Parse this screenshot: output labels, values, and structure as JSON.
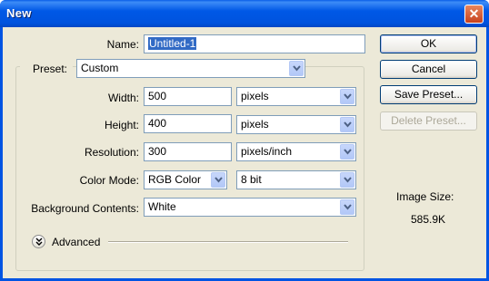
{
  "window": {
    "title": "New",
    "close_glyph": "✕"
  },
  "form": {
    "name_label": "Name:",
    "name_value": "Untitled-1",
    "preset_label": "Preset:",
    "preset_value": "Custom",
    "width_label": "Width:",
    "width_value": "500",
    "width_unit": "pixels",
    "height_label": "Height:",
    "height_value": "400",
    "height_unit": "pixels",
    "resolution_label": "Resolution:",
    "resolution_value": "300",
    "resolution_unit": "pixels/inch",
    "color_mode_label": "Color Mode:",
    "color_mode_value": "RGB Color",
    "bit_depth_value": "8 bit",
    "background_label": "Background Contents:",
    "background_value": "White",
    "advanced_label": "Advanced"
  },
  "buttons": {
    "ok": "OK",
    "cancel": "Cancel",
    "save_preset": "Save Preset...",
    "delete_preset": "Delete Preset..."
  },
  "image_size": {
    "label": "Image Size:",
    "value": "585.9K"
  },
  "icons": {
    "dropdown": "chevron-down-icon",
    "advanced": "double-chevron-down-icon",
    "close": "close-icon"
  },
  "colors": {
    "titlebar": "#0058e6",
    "dialog_bg": "#ece9d8",
    "selection": "#316ac5"
  }
}
